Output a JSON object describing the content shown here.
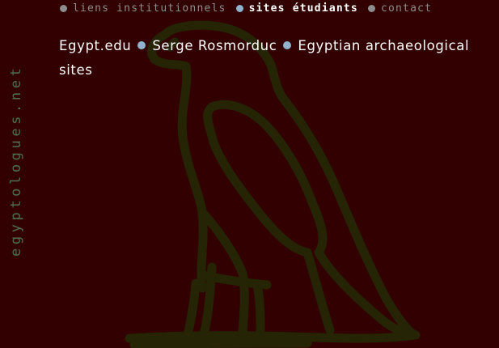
{
  "site": {
    "vertical_title": "egyptologues.net"
  },
  "nav": {
    "items": [
      {
        "label": "liens institutionnels",
        "active": false
      },
      {
        "label": "sites étudiants",
        "active": true
      },
      {
        "label": "contact",
        "active": false
      }
    ]
  },
  "main": {
    "links": [
      {
        "label": "Egypt.edu"
      },
      {
        "label": "Serge Rosmorduc"
      },
      {
        "label": "Egyptian archaeological sites"
      }
    ]
  },
  "background": {
    "illustration": "vulture-hieroglyph"
  },
  "colors": {
    "background": "#320000",
    "illustration": "#252405",
    "side_title": "#4f6e4f",
    "nav_muted": "#8d8d8d",
    "nav_active": "#ffffff",
    "bullet_grey": "#8d8d8d",
    "bullet_blue": "#8fb2cf",
    "link_text": "#ffffff"
  }
}
